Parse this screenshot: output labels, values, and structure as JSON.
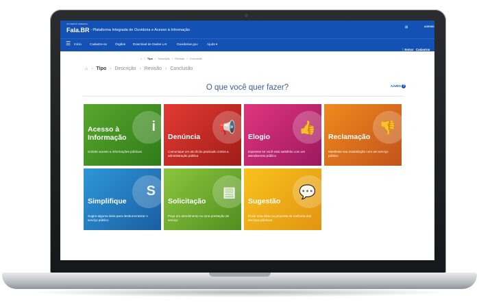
{
  "header": {
    "gov_text": "GOVERNO FEDERAL",
    "logo": "Fala.BR",
    "subtitle": "- Plataforma Integrada de Ouvidoria e Acesso à Informação",
    "access_label": "ACESSO"
  },
  "nav": {
    "items": [
      "Início",
      "Cadastre-se",
      "Órgãos",
      "Download de Dados LAI",
      "Ouvidorias.gov",
      "Ajuda ▾"
    ],
    "entrar": "Entrar",
    "cadastrar": "Cadastrar"
  },
  "breadcrumb_small": {
    "items": [
      "Tipo",
      "Descrição",
      "Revisão",
      "Conclusão"
    ]
  },
  "breadcrumb": {
    "items": [
      "Tipo",
      "Descrição",
      "Revisão",
      "Conclusão"
    ]
  },
  "main": {
    "heading": "O que você quer fazer?",
    "help_label": "AJUDA"
  },
  "tiles": [
    {
      "title": "Acesso à Informação",
      "desc": "Solicite acesso a informações públicas",
      "icon": "info-icon",
      "color": "#3e8f24"
    },
    {
      "title": "Denúncia",
      "desc": "Comunique um ato ilícito praticado contra a administração pública",
      "icon": "megaphone-icon",
      "color": "#c6271f"
    },
    {
      "title": "Elogio",
      "desc": "Expresse se você está satisfeito com um atendimento público",
      "icon": "thumbs-up-icon",
      "color": "#c42570"
    },
    {
      "title": "Reclamação",
      "desc": "Manifeste sua insatisfação com um serviço público",
      "icon": "thumbs-down-icon",
      "color": "#d96e1c"
    },
    {
      "title": "Simplifique",
      "desc": "Sugira alguma ideia para desburocratizar o serviço público",
      "icon": "simplifique-s-icon",
      "color": "#2379bd"
    },
    {
      "title": "Solicitação",
      "desc": "Peça um atendimento ou uma prestação de serviço",
      "icon": "form-icon",
      "color": "#6faa2e"
    },
    {
      "title": "Sugestão",
      "desc": "Envie uma ideia ou proposta de melhoria dos serviços públicos",
      "icon": "speech-bubble-icon",
      "color": "#efab17"
    }
  ]
}
